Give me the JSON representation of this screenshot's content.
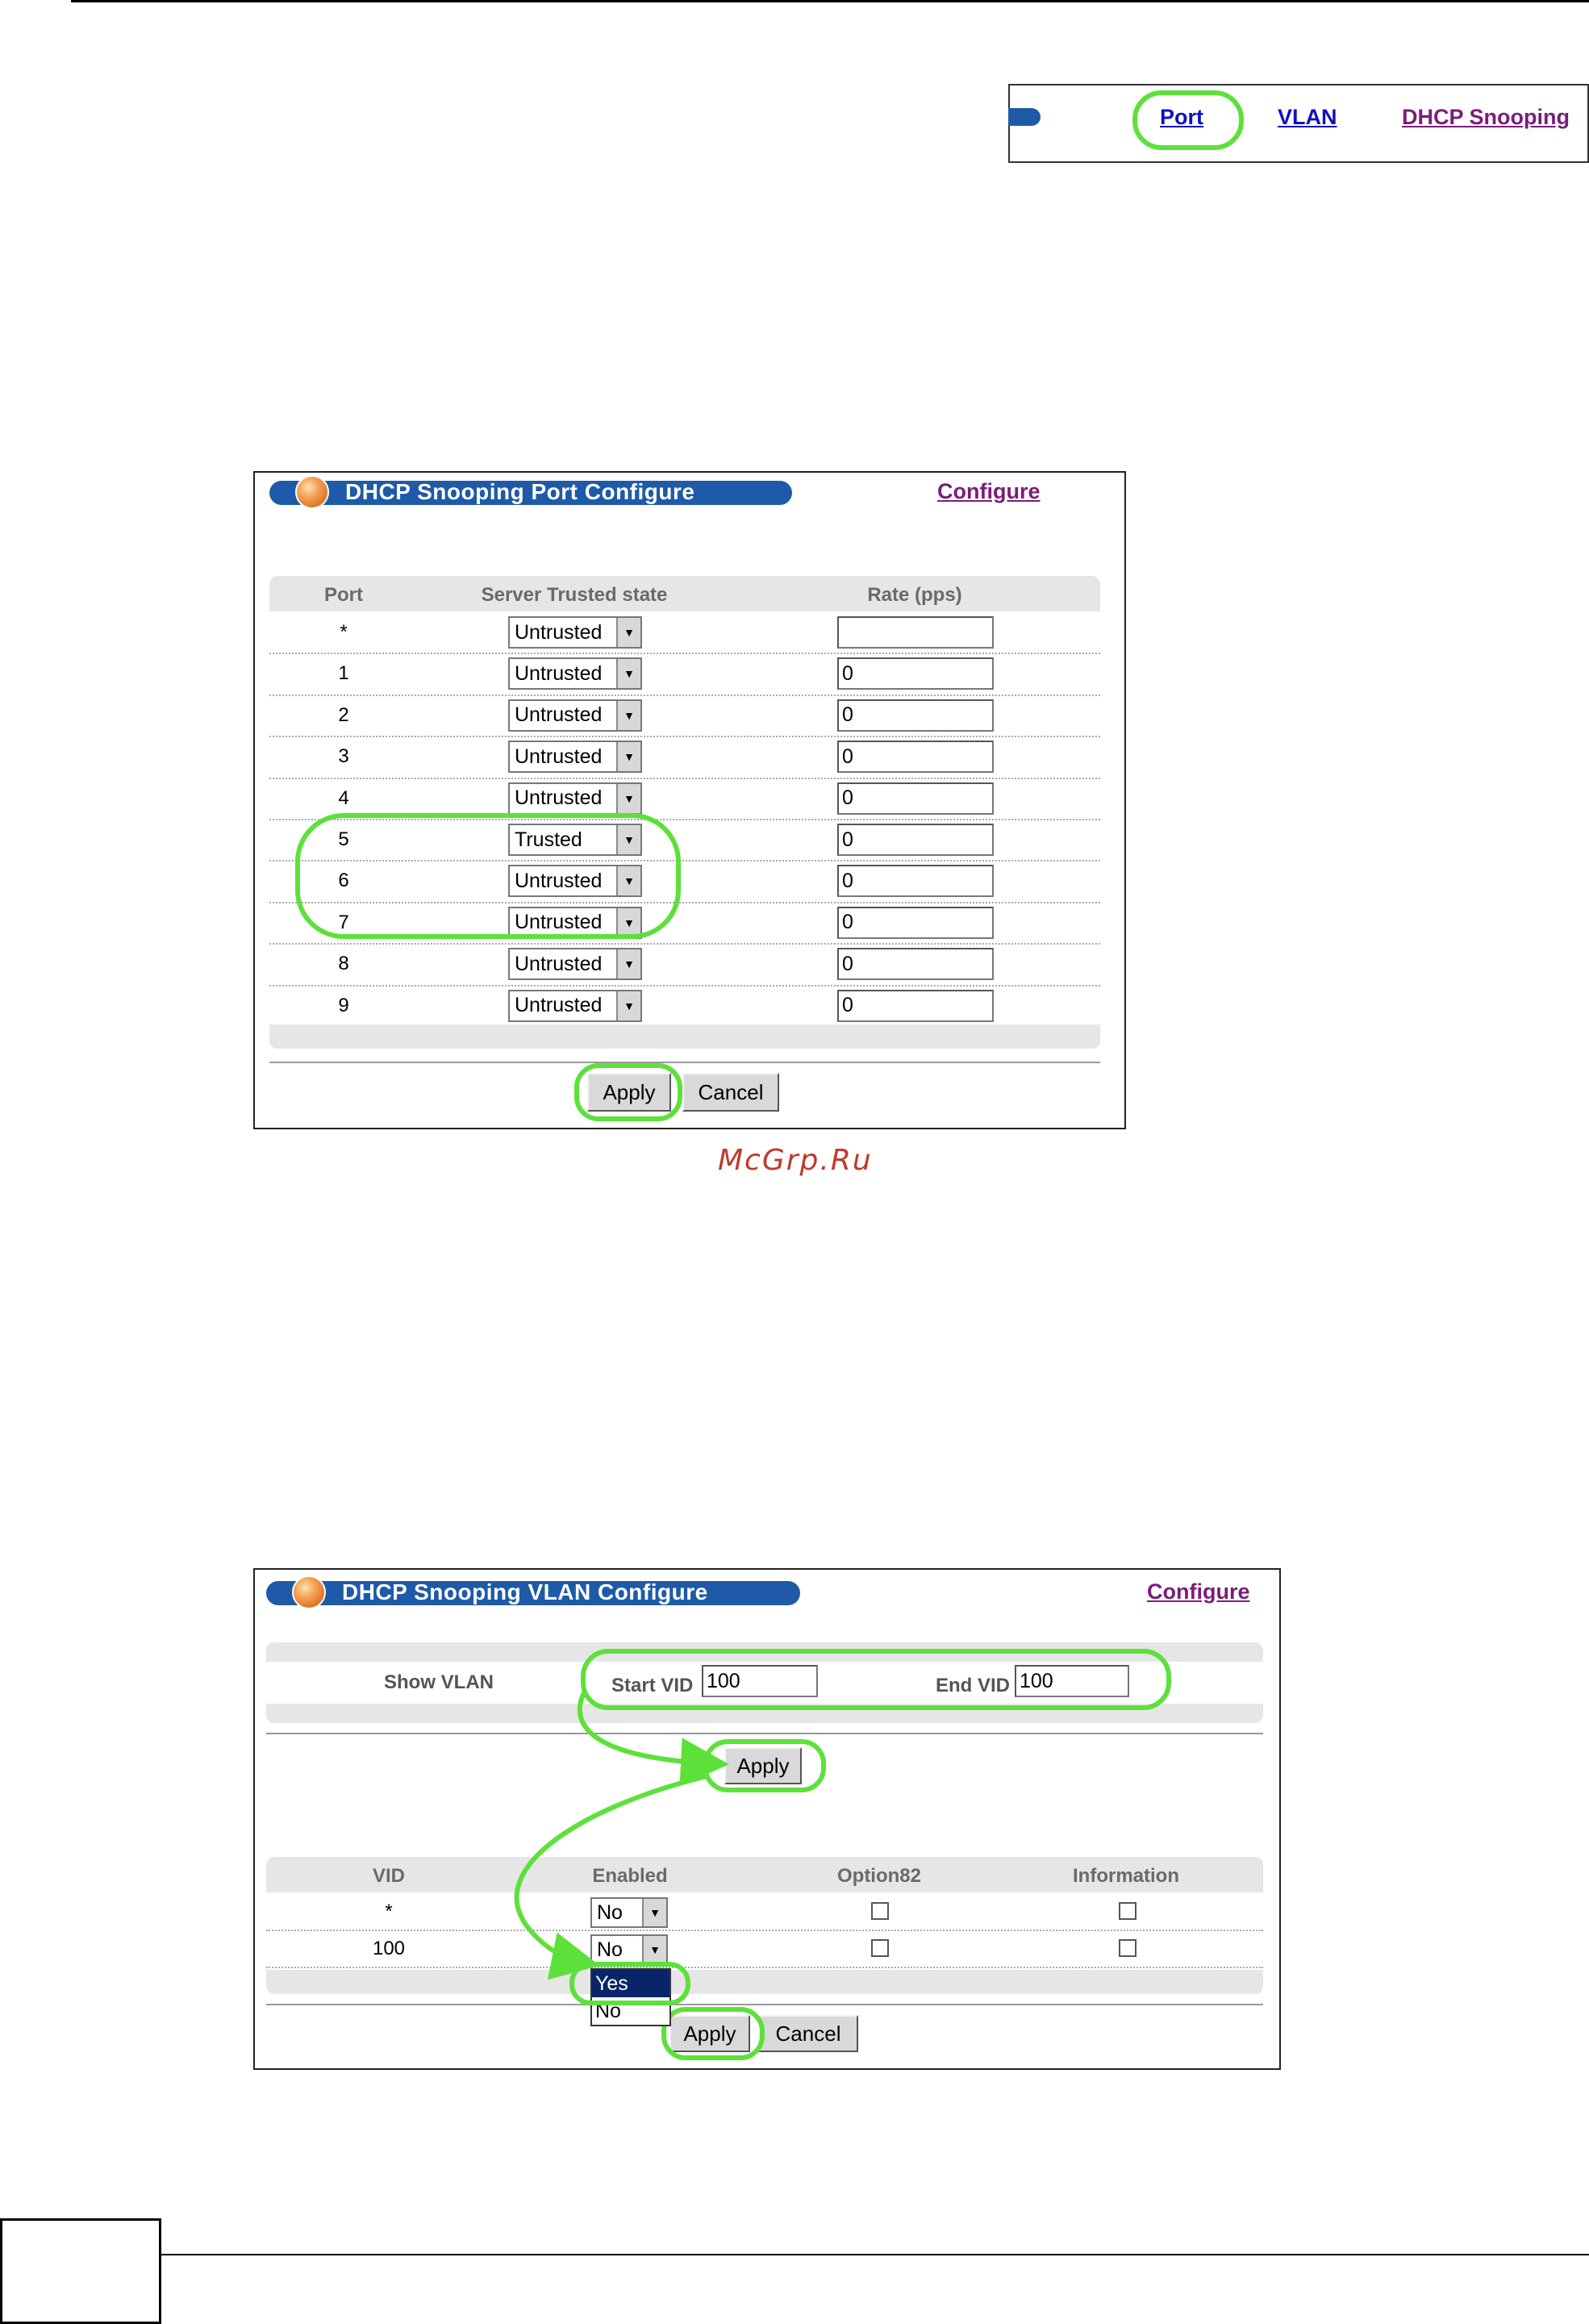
{
  "nav": {
    "links": [
      "Port",
      "VLAN",
      "DHCP Snooping"
    ]
  },
  "port_panel": {
    "title": "DHCP Snooping Port Configure",
    "configure_link": "Configure",
    "columns": [
      "Port",
      "Server Trusted state",
      "Rate (pps)"
    ],
    "rows": [
      {
        "port": "*",
        "state": "Untrusted",
        "rate": ""
      },
      {
        "port": "1",
        "state": "Untrusted",
        "rate": "0"
      },
      {
        "port": "2",
        "state": "Untrusted",
        "rate": "0"
      },
      {
        "port": "3",
        "state": "Untrusted",
        "rate": "0"
      },
      {
        "port": "4",
        "state": "Untrusted",
        "rate": "0"
      },
      {
        "port": "5",
        "state": "Trusted",
        "rate": "0"
      },
      {
        "port": "6",
        "state": "Untrusted",
        "rate": "0"
      },
      {
        "port": "7",
        "state": "Untrusted",
        "rate": "0"
      },
      {
        "port": "8",
        "state": "Untrusted",
        "rate": "0"
      },
      {
        "port": "9",
        "state": "Untrusted",
        "rate": "0"
      }
    ],
    "apply_label": "Apply",
    "cancel_label": "Cancel"
  },
  "watermark": "McGrp.Ru",
  "vlan_panel": {
    "title": "DHCP Snooping VLAN Configure",
    "configure_link": "Configure",
    "show_vlan_label": "Show VLAN",
    "start_vid_label": "Start VID",
    "start_vid_value": "100",
    "end_vid_label": "End VID",
    "end_vid_value": "100",
    "show_apply_label": "Apply",
    "columns": [
      "VID",
      "Enabled",
      "Option82",
      "Information"
    ],
    "rows": [
      {
        "vid": "*",
        "enabled": "No"
      },
      {
        "vid": "100",
        "enabled": "No"
      }
    ],
    "dropdown_options": [
      "Yes",
      "No"
    ],
    "apply_label": "Apply",
    "cancel_label": "Cancel"
  },
  "colors": {
    "accent_blue": "#1e5aa8",
    "highlight_green": "#5de13a",
    "visited_link": "#7a1d7a",
    "link_blue": "#1010c0"
  }
}
